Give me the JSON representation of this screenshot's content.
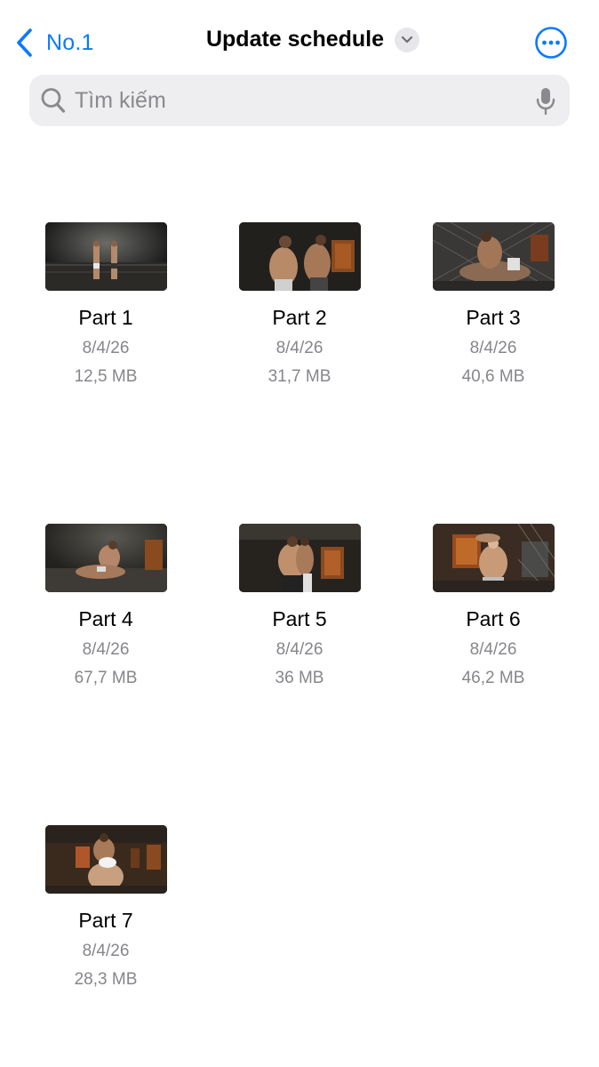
{
  "nav": {
    "back_label": "No.1",
    "title": "Update schedule"
  },
  "search": {
    "placeholder": "Tìm kiếm"
  },
  "files": [
    {
      "name": "Part 1",
      "date": "8/4/26",
      "size": "12,5 MB"
    },
    {
      "name": "Part 2",
      "date": "8/4/26",
      "size": "31,7 MB"
    },
    {
      "name": "Part 3",
      "date": "8/4/26",
      "size": "40,6 MB"
    },
    {
      "name": "Part 4",
      "date": "8/4/26",
      "size": "67,7 MB"
    },
    {
      "name": "Part 5",
      "date": "8/4/26",
      "size": "36 MB"
    },
    {
      "name": "Part 6",
      "date": "8/4/26",
      "size": "46,2 MB"
    },
    {
      "name": "Part 7",
      "date": "8/4/26",
      "size": "28,3 MB"
    }
  ],
  "colors": {
    "accent": "#0a7aff",
    "secondary_text": "#86868b",
    "search_bg": "#eeeef0"
  }
}
